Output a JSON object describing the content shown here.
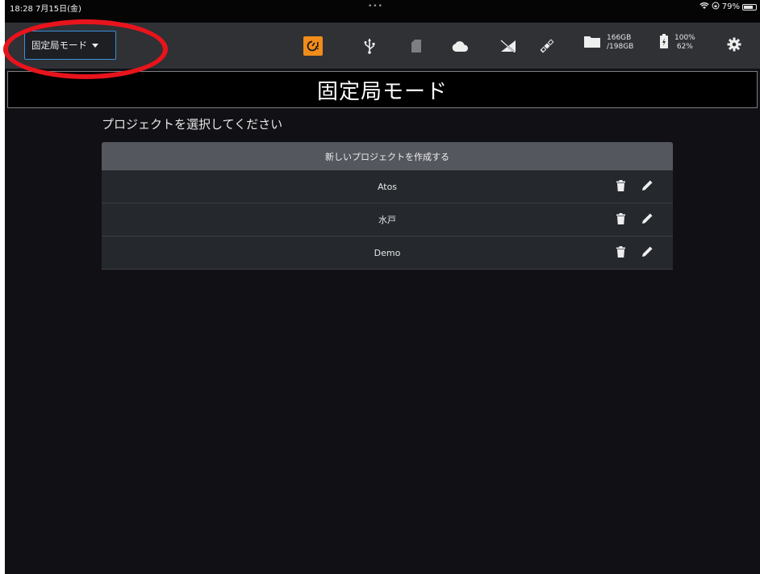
{
  "status_bar": {
    "time": "18:28  7月15日(金)",
    "dots": "•••",
    "battery_percent": "79%"
  },
  "toolbar": {
    "mode_select": "固定局モード",
    "storage_used": "166GB",
    "storage_total": "/198GB",
    "battery_top": "100%",
    "battery_bottom": "62%"
  },
  "header": {
    "title": "固定局モード"
  },
  "main": {
    "prompt": "プロジェクトを選択してください",
    "new_project_label": "新しいプロジェクトを作成する",
    "projects": [
      {
        "name": "Atos"
      },
      {
        "name": "水戸"
      },
      {
        "name": "Demo"
      }
    ]
  },
  "colors": {
    "accent_orange": "#f08c1b",
    "select_border": "#3b8fd9",
    "annotation_red": "#e8141c",
    "background": "#111115"
  },
  "icons": [
    "timer-alert-icon",
    "usb-icon",
    "sd-card-icon",
    "cloud-icon",
    "antenna-off-icon",
    "satellite-icon",
    "folder-icon",
    "battery-charging-icon",
    "gear-icon",
    "trash-icon",
    "pencil-icon"
  ]
}
